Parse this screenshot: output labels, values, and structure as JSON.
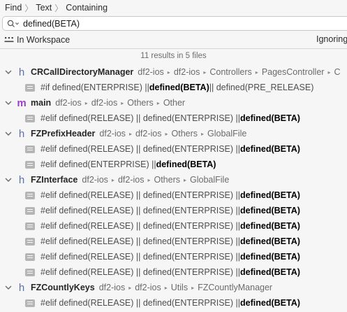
{
  "breadcrumb": [
    "Find",
    "Text",
    "Containing"
  ],
  "search": {
    "value": "defined(BETA)"
  },
  "scope": {
    "label": "In Workspace",
    "right_label": "Ignoring"
  },
  "summary": "11 results in 5 files",
  "files": [
    {
      "icon": "h",
      "name": "CRCallDirectoryManager",
      "path": [
        "df2-ios",
        "df2-ios",
        "Controllers",
        "PagesController",
        "C"
      ],
      "matches": [
        {
          "pre": "#if defined(ENTERPRISE) || ",
          "hit": "defined(BETA)",
          "post": " || defined(PRE_RELEASE)"
        }
      ]
    },
    {
      "icon": "m",
      "name": "main",
      "path": [
        "df2-ios",
        "df2-ios",
        "Others",
        "Other"
      ],
      "matches": [
        {
          "pre": "#elif defined(RELEASE) || defined(ENTERPRISE) || ",
          "hit": "defined(BETA)",
          "post": ""
        }
      ]
    },
    {
      "icon": "h",
      "name": "FZPrefixHeader",
      "path": [
        "df2-ios",
        "df2-ios",
        "Others",
        "GlobalFile"
      ],
      "matches": [
        {
          "pre": "#elif defined(RELEASE) || defined(ENTERPRISE) || ",
          "hit": "defined(BETA)",
          "post": ""
        },
        {
          "pre": "#elif defined(ENTERPRISE) || ",
          "hit": "defined(BETA)",
          "post": ""
        }
      ]
    },
    {
      "icon": "h",
      "name": "FZInterface",
      "path": [
        "df2-ios",
        "df2-ios",
        "Others",
        "GlobalFile"
      ],
      "matches": [
        {
          "pre": "#elif defined(RELEASE) || defined(ENTERPRISE) || ",
          "hit": "defined(BETA)",
          "post": ""
        },
        {
          "pre": "#elif defined(RELEASE) || defined(ENTERPRISE) || ",
          "hit": "defined(BETA)",
          "post": ""
        },
        {
          "pre": "#elif defined(RELEASE) || defined(ENTERPRISE) || ",
          "hit": "defined(BETA)",
          "post": ""
        },
        {
          "pre": "#elif defined(RELEASE) || defined(ENTERPRISE) || ",
          "hit": "defined(BETA)",
          "post": ""
        },
        {
          "pre": "#elif defined(RELEASE) || defined(ENTERPRISE) || ",
          "hit": "defined(BETA)",
          "post": ""
        },
        {
          "pre": "#elif defined(RELEASE) || defined(ENTERPRISE) || ",
          "hit": "defined(BETA)",
          "post": ""
        }
      ]
    },
    {
      "icon": "h",
      "name": "FZCountlyKeys",
      "path": [
        "df2-ios",
        "df2-ios",
        "Utils",
        "FZCountlyManager"
      ],
      "matches": [
        {
          "pre": "#elif defined(RELEASE) || defined(ENTERPRISE) || ",
          "hit": "defined(BETA)",
          "post": ""
        }
      ]
    }
  ],
  "colors": {
    "header_icon": "#5b6fa8",
    "objc_icon": "#9b3fc7",
    "background": "#f6f6f6"
  }
}
